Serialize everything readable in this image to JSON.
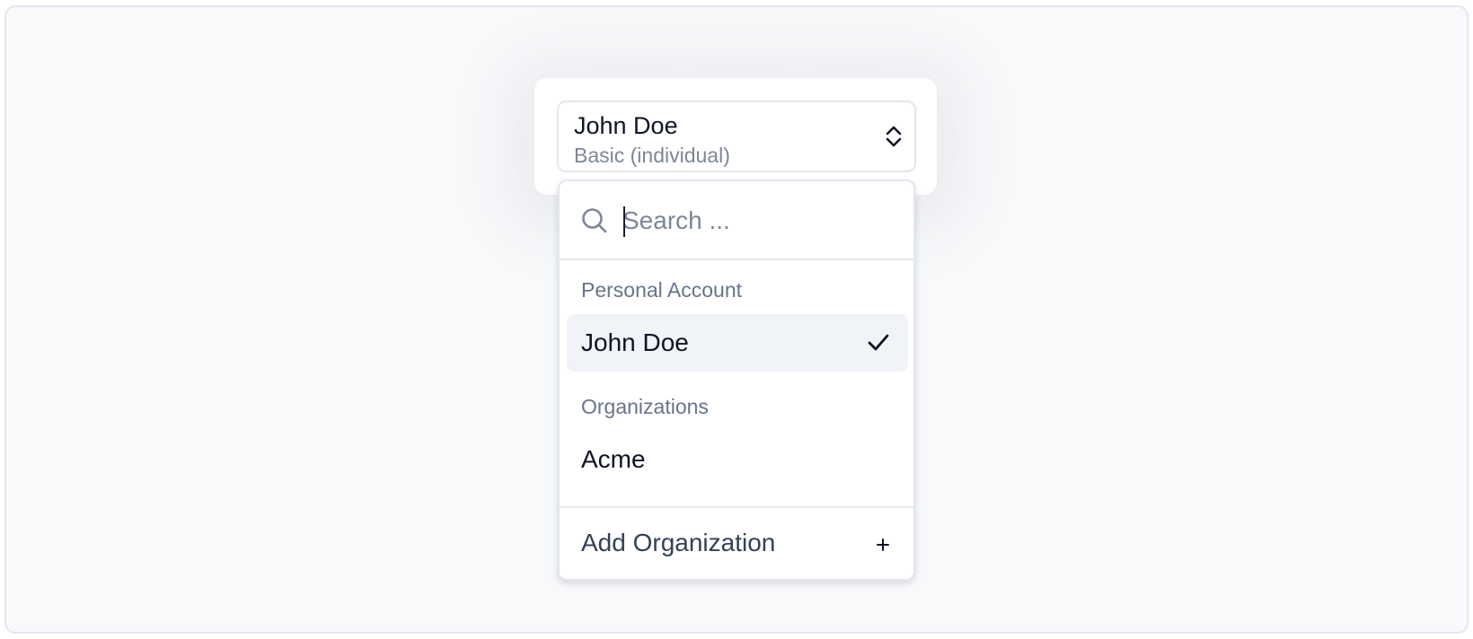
{
  "account_switcher": {
    "current_account": {
      "name": "John Doe",
      "plan": "Basic (individual)"
    },
    "trigger_icon": "chevron-up-down-icon"
  },
  "dropdown": {
    "search": {
      "placeholder": "Search ...",
      "value": "",
      "icon": "search-icon"
    },
    "groups": [
      {
        "label": "Personal Account",
        "items": [
          {
            "label": "John Doe",
            "selected": true,
            "icon": "check-icon"
          }
        ]
      },
      {
        "label": "Organizations",
        "items": [
          {
            "label": "Acme",
            "selected": false
          }
        ]
      }
    ],
    "footer": {
      "label": "Add Organization",
      "icon": "plus-icon"
    }
  },
  "colors": {
    "background": "#f8f9fb",
    "selected_item_bg": "#f0f3f8",
    "group_label": "#65758a",
    "muted_text": "#7c8796",
    "text": "#0e1424",
    "border": "#e3e6ee"
  }
}
